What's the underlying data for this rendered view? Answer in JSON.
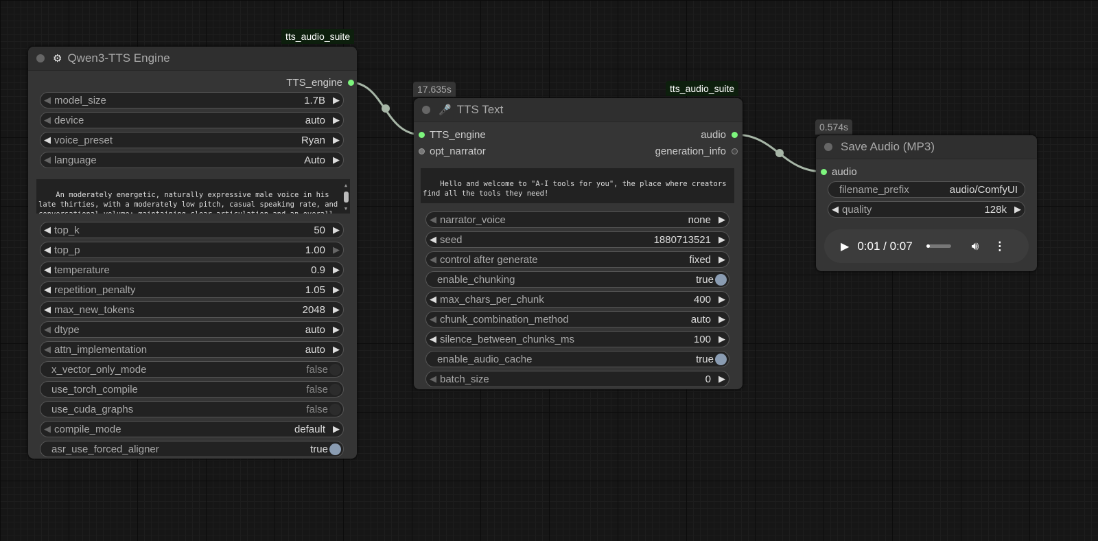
{
  "colors": {
    "link": "#a7b6a7",
    "slot_active": "#7df57d",
    "toggle_on": "#8a9cb2"
  },
  "nodes": {
    "engine": {
      "badge": "tts_audio_suite",
      "title": "Qwen3-TTS Engine",
      "icon": "gear-icon",
      "outputs": [
        "TTS_engine"
      ],
      "widgets_a": [
        {
          "type": "combo",
          "label": "model_size",
          "value": "1.7B",
          "left": false,
          "right": true
        },
        {
          "type": "combo",
          "label": "device",
          "value": "auto",
          "left": false,
          "right": true
        },
        {
          "type": "combo",
          "label": "voice_preset",
          "value": "Ryan",
          "left": true,
          "right": true
        },
        {
          "type": "combo",
          "label": "language",
          "value": "Auto",
          "left": false,
          "right": true
        }
      ],
      "text": "An moderately energetic, naturally expressive male voice in his late thirties, with a moderately low pitch, casual speaking rate, and conversational volume; maintaining clear articulation and an overall warm, approachable clarity. Speaking on ted-talks",
      "widgets_b": [
        {
          "type": "combo",
          "label": "top_k",
          "value": "50",
          "left": true,
          "right": true
        },
        {
          "type": "combo",
          "label": "top_p",
          "value": "1.00",
          "left": true,
          "right": false
        },
        {
          "type": "combo",
          "label": "temperature",
          "value": "0.9",
          "left": true,
          "right": true
        },
        {
          "type": "combo",
          "label": "repetition_penalty",
          "value": "1.05",
          "left": true,
          "right": true
        },
        {
          "type": "combo",
          "label": "max_new_tokens",
          "value": "2048",
          "left": true,
          "right": true
        },
        {
          "type": "combo",
          "label": "dtype",
          "value": "auto",
          "left": false,
          "right": true
        },
        {
          "type": "combo",
          "label": "attn_implementation",
          "value": "auto",
          "left": false,
          "right": true
        },
        {
          "type": "toggle",
          "label": "x_vector_only_mode",
          "value": "false",
          "on": false
        },
        {
          "type": "toggle",
          "label": "use_torch_compile",
          "value": "false",
          "on": false
        },
        {
          "type": "toggle",
          "label": "use_cuda_graphs",
          "value": "false",
          "on": false
        },
        {
          "type": "combo",
          "label": "compile_mode",
          "value": "default",
          "left": false,
          "right": true
        },
        {
          "type": "toggle",
          "label": "asr_use_forced_aligner",
          "value": "true",
          "on": true
        }
      ]
    },
    "text": {
      "badge": "tts_audio_suite",
      "time": "17.635s",
      "title": "TTS Text",
      "icon": "microphone-icon",
      "inputs": [
        "TTS_engine",
        "opt_narrator"
      ],
      "outputs": [
        "audio",
        "generation_info"
      ],
      "text": "Hello and welcome to \"A-I tools for you\", the place where creators find all the tools they need!",
      "widgets": [
        {
          "type": "combo",
          "label": "narrator_voice",
          "value": "none",
          "left": false,
          "right": true
        },
        {
          "type": "combo",
          "label": "seed",
          "value": "1880713521",
          "left": true,
          "right": true
        },
        {
          "type": "combo",
          "label": "control after generate",
          "value": "fixed",
          "left": false,
          "right": true
        },
        {
          "type": "toggle",
          "label": "enable_chunking",
          "value": "true",
          "on": true
        },
        {
          "type": "combo",
          "label": "max_chars_per_chunk",
          "value": "400",
          "left": true,
          "right": true
        },
        {
          "type": "combo",
          "label": "chunk_combination_method",
          "value": "auto",
          "left": false,
          "right": true
        },
        {
          "type": "combo",
          "label": "silence_between_chunks_ms",
          "value": "100",
          "left": true,
          "right": true
        },
        {
          "type": "toggle",
          "label": "enable_audio_cache",
          "value": "true",
          "on": true
        },
        {
          "type": "combo",
          "label": "batch_size",
          "value": "0",
          "left": false,
          "right": true
        }
      ]
    },
    "save": {
      "time": "0.574s",
      "title": "Save Audio (MP3)",
      "inputs": [
        "audio"
      ],
      "widgets": [
        {
          "type": "text",
          "label": "filename_prefix",
          "value": "audio/ComfyUI"
        },
        {
          "type": "combo",
          "label": "quality",
          "value": "128k",
          "left": true,
          "right": true
        }
      ],
      "player": {
        "time": "0:01 / 0:07",
        "progress": 0.14
      }
    }
  }
}
